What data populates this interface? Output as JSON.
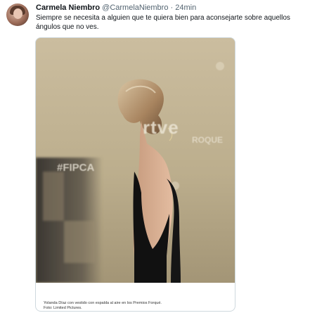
{
  "tweet": {
    "author_name": "Carmela Niembro",
    "author_handle": "@CarmelaNiembro",
    "separator": "·",
    "time": "24min",
    "text": "Siempre se necesita a alguien que te quiera bien para aconsejarte sobre aquellos ángulos que no ves.",
    "media": {
      "wall_text_1": "rtve",
      "wall_text_2": "#FIPCA",
      "wall_text_3": "ROQUE",
      "caption_line_1": "Yolanda Díaz con vestido con espalda al aire en los Premios Forqué.",
      "caption_line_2": "Foto: Limited Pictures."
    }
  },
  "colors": {
    "text_primary": "#0f1419",
    "text_secondary": "#536471",
    "border": "#cfd9de",
    "photo_background": "#bdb08f"
  },
  "icons": {
    "avatar": "profile-photo"
  }
}
